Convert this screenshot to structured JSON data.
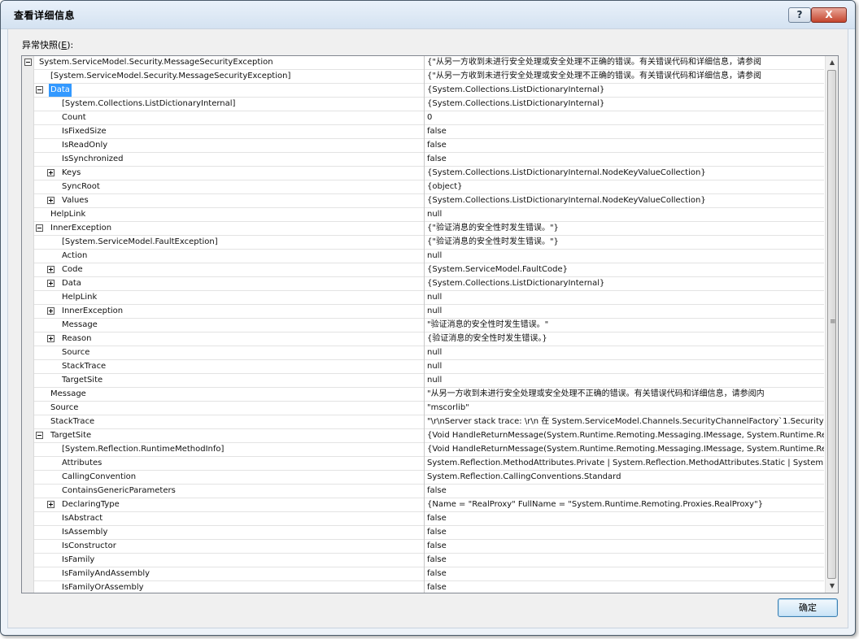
{
  "window": {
    "title": "查看详细信息",
    "help_symbol": "?",
    "close_symbol": "X"
  },
  "snapshot": {
    "label_prefix": "异常快照(",
    "label_key": "E",
    "label_suffix": "):"
  },
  "rows": [
    {
      "level": 0,
      "exp": "minus",
      "name": "System.ServiceModel.Security.MessageSecurityException",
      "value": "{\"从另一方收到未进行安全处理或安全处理不正确的错误。有关错误代码和详细信息，请参阅"
    },
    {
      "level": 1,
      "exp": "",
      "name": "[System.ServiceModel.Security.MessageSecurityException]",
      "value": "{\"从另一方收到未进行安全处理或安全处理不正确的错误。有关错误代码和详细信息，请参阅"
    },
    {
      "level": 1,
      "exp": "minus",
      "name": "Data",
      "value": "{System.Collections.ListDictionaryInternal}",
      "selected": true
    },
    {
      "level": 2,
      "exp": "",
      "name": "[System.Collections.ListDictionaryInternal]",
      "value": "{System.Collections.ListDictionaryInternal}"
    },
    {
      "level": 2,
      "exp": "",
      "name": "Count",
      "value": "0"
    },
    {
      "level": 2,
      "exp": "",
      "name": "IsFixedSize",
      "value": "false"
    },
    {
      "level": 2,
      "exp": "",
      "name": "IsReadOnly",
      "value": "false"
    },
    {
      "level": 2,
      "exp": "",
      "name": "IsSynchronized",
      "value": "false"
    },
    {
      "level": 2,
      "exp": "plus",
      "name": "Keys",
      "value": "{System.Collections.ListDictionaryInternal.NodeKeyValueCollection}"
    },
    {
      "level": 2,
      "exp": "",
      "name": "SyncRoot",
      "value": "{object}"
    },
    {
      "level": 2,
      "exp": "plus",
      "name": "Values",
      "value": "{System.Collections.ListDictionaryInternal.NodeKeyValueCollection}"
    },
    {
      "level": 1,
      "exp": "",
      "name": "HelpLink",
      "value": "null"
    },
    {
      "level": 1,
      "exp": "minus",
      "name": "InnerException",
      "value": "{\"验证消息的安全性时发生错误。\"}"
    },
    {
      "level": 2,
      "exp": "",
      "name": "[System.ServiceModel.FaultException]",
      "value": "{\"验证消息的安全性时发生错误。\"}"
    },
    {
      "level": 2,
      "exp": "",
      "name": "Action",
      "value": "null"
    },
    {
      "level": 2,
      "exp": "plus",
      "name": "Code",
      "value": "{System.ServiceModel.FaultCode}"
    },
    {
      "level": 2,
      "exp": "plus",
      "name": "Data",
      "value": "{System.Collections.ListDictionaryInternal}"
    },
    {
      "level": 2,
      "exp": "",
      "name": "HelpLink",
      "value": "null"
    },
    {
      "level": 2,
      "exp": "plus",
      "name": "InnerException",
      "value": "null"
    },
    {
      "level": 2,
      "exp": "",
      "name": "Message",
      "value": "\"验证消息的安全性时发生错误。\""
    },
    {
      "level": 2,
      "exp": "plus",
      "name": "Reason",
      "value": "{验证消息的安全性时发生错误。}"
    },
    {
      "level": 2,
      "exp": "",
      "name": "Source",
      "value": "null"
    },
    {
      "level": 2,
      "exp": "",
      "name": "StackTrace",
      "value": "null"
    },
    {
      "level": 2,
      "exp": "",
      "name": "TargetSite",
      "value": "null"
    },
    {
      "level": 1,
      "exp": "",
      "name": "Message",
      "value": "\"从另一方收到未进行安全处理或安全处理不正确的错误。有关错误代码和详细信息，请参阅内"
    },
    {
      "level": 1,
      "exp": "",
      "name": "Source",
      "value": "\"mscorlib\""
    },
    {
      "level": 1,
      "exp": "",
      "name": "StackTrace",
      "value": "\"\\r\\nServer stack trace: \\r\\n   在 System.ServiceModel.Channels.SecurityChannelFactory`1.SecurityR"
    },
    {
      "level": 1,
      "exp": "minus",
      "name": "TargetSite",
      "value": "{Void HandleReturnMessage(System.Runtime.Remoting.Messaging.IMessage, System.Runtime.Remot"
    },
    {
      "level": 2,
      "exp": "",
      "name": "[System.Reflection.RuntimeMethodInfo]",
      "value": "{Void HandleReturnMessage(System.Runtime.Remoting.Messaging.IMessage, System.Runtime.Remot"
    },
    {
      "level": 2,
      "exp": "",
      "name": "Attributes",
      "value": "System.Reflection.MethodAttributes.Private | System.Reflection.MethodAttributes.Static | System.Re"
    },
    {
      "level": 2,
      "exp": "",
      "name": "CallingConvention",
      "value": "System.Reflection.CallingConventions.Standard"
    },
    {
      "level": 2,
      "exp": "",
      "name": "ContainsGenericParameters",
      "value": "false"
    },
    {
      "level": 2,
      "exp": "plus",
      "name": "DeclaringType",
      "value": "{Name = \"RealProxy\" FullName = \"System.Runtime.Remoting.Proxies.RealProxy\"}"
    },
    {
      "level": 2,
      "exp": "",
      "name": "IsAbstract",
      "value": "false"
    },
    {
      "level": 2,
      "exp": "",
      "name": "IsAssembly",
      "value": "false"
    },
    {
      "level": 2,
      "exp": "",
      "name": "IsConstructor",
      "value": "false"
    },
    {
      "level": 2,
      "exp": "",
      "name": "IsFamily",
      "value": "false"
    },
    {
      "level": 2,
      "exp": "",
      "name": "IsFamilyAndAssembly",
      "value": "false"
    },
    {
      "level": 2,
      "exp": "",
      "name": "IsFamilyOrAssembly",
      "value": "false"
    }
  ],
  "scrollbar": {
    "up_arrow": "▲",
    "down_arrow": "▼",
    "grip": "≡"
  },
  "footer": {
    "ok_label": "确定"
  },
  "colors": {
    "selection": "#3399ff",
    "close_button": "#c5452d"
  }
}
